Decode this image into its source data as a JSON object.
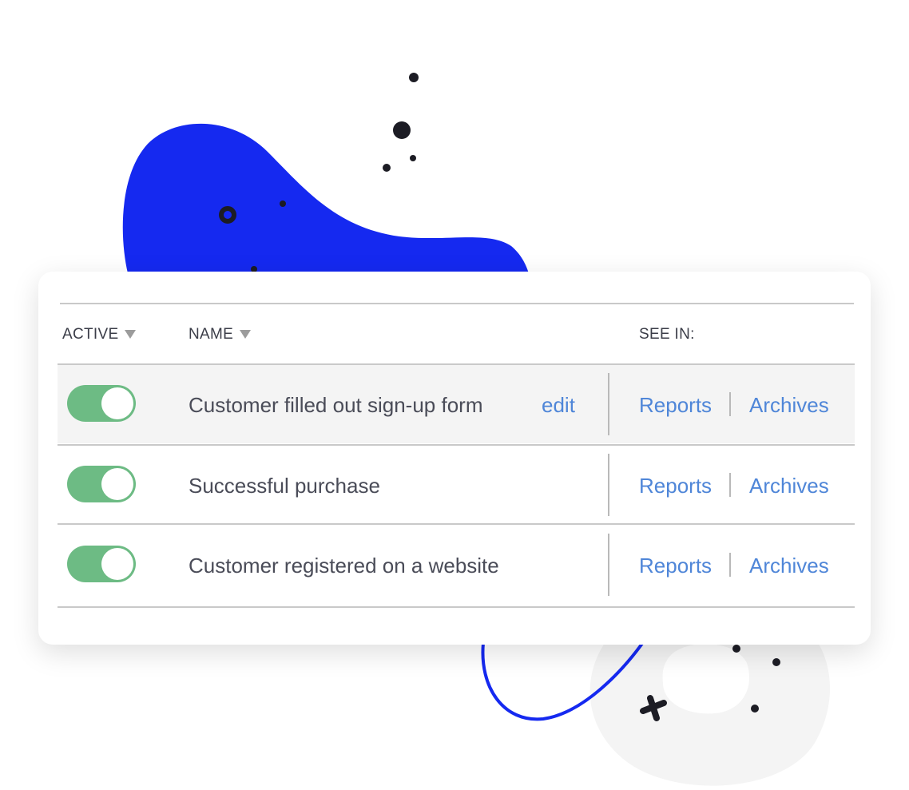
{
  "colors": {
    "accent_blue": "#1529f0",
    "toggle_on": "#6dbb84",
    "link": "#4f86d8",
    "text": "#4a4c58",
    "row_highlight": "#f4f4f4"
  },
  "table": {
    "columns": {
      "active": "ACTIVE",
      "name": "NAME",
      "see_in": "SEE IN:"
    },
    "rows": [
      {
        "active": true,
        "name": "Customer filled out sign-up form",
        "edit": "edit",
        "reports": "Reports",
        "archives": "Archives",
        "highlighted": true
      },
      {
        "active": true,
        "name": "Successful purchase",
        "reports": "Reports",
        "archives": "Archives",
        "highlighted": false
      },
      {
        "active": true,
        "name": "Customer registered on a website",
        "reports": "Reports",
        "archives": "Archives",
        "highlighted": false
      }
    ]
  },
  "icons": {
    "sort": "triangle-down-icon",
    "toggle": "toggle-switch-on"
  }
}
